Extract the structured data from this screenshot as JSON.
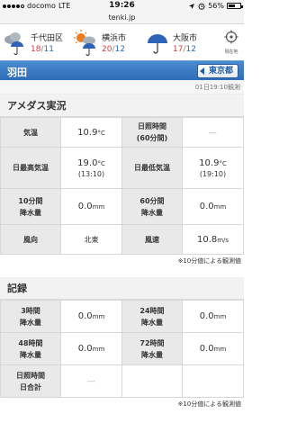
{
  "status_bar": {
    "carrier": "docomo",
    "network": "LTE",
    "time": "19:26",
    "battery": "56%",
    "battery_level": 0.56
  },
  "url_bar": {
    "domain": "tenki.jp"
  },
  "forecast": {
    "cities": [
      {
        "name": "千代田区",
        "high": "18",
        "low": "11",
        "icon": "cloud-umbrella-icon"
      },
      {
        "name": "横浜市",
        "high": "20",
        "low": "12",
        "icon": "sun-cloud-umbrella-icon"
      },
      {
        "name": "大阪市",
        "high": "17",
        "low": "12",
        "icon": "umbrella-icon"
      }
    ],
    "separator": "/",
    "locate_label": "現在地"
  },
  "title_bar": {
    "title": "羽田",
    "prefecture_button": "東京都"
  },
  "observed_time": "01日19:10観測",
  "amedas": {
    "heading": "アメダス実況",
    "rows": [
      {
        "l1": "気温",
        "v1_num": "10.9",
        "v1_unit": "°C",
        "l2": "日照時間",
        "l2_sub": "(60分間)",
        "v2": "---"
      },
      {
        "l1": "日最高気温",
        "v1_num": "19.0",
        "v1_unit": "°C",
        "v1_sub": "(13:10)",
        "l2": "日最低気温",
        "v2_num": "10.9",
        "v2_unit": "°C",
        "v2_sub": "(19:10)"
      },
      {
        "l1a": "10分間",
        "l1b": "降水量",
        "v1_num": "0.0",
        "v1_unit": "mm",
        "l2a": "60分間",
        "l2b": "降水量",
        "v2_num": "0.0",
        "v2_unit": "mm"
      },
      {
        "l1": "風向",
        "v1": "北東",
        "l2": "風速",
        "v2_num": "10.8",
        "v2_unit": "m/s"
      }
    ],
    "note": "※10分値による観測値"
  },
  "records": {
    "heading": "記録",
    "rows": [
      {
        "l1a": "3時間",
        "l1b": "降水量",
        "v1_num": "0.0",
        "v1_unit": "mm",
        "l2a": "24時間",
        "l2b": "降水量",
        "v2_num": "0.0",
        "v2_unit": "mm"
      },
      {
        "l1a": "48時間",
        "l1b": "降水量",
        "v1_num": "0.0",
        "v1_unit": "mm",
        "l2a": "72時間",
        "l2b": "降水量",
        "v2_num": "0.0",
        "v2_unit": "mm"
      },
      {
        "l1a": "日照時間",
        "l1b": "日合計",
        "v1": "---"
      }
    ],
    "note": "※10分値による観測値"
  },
  "colors": {
    "title_bar": "#3a7cc6",
    "high_temp": "#d63c3c",
    "low_temp": "#2b6fb9"
  }
}
